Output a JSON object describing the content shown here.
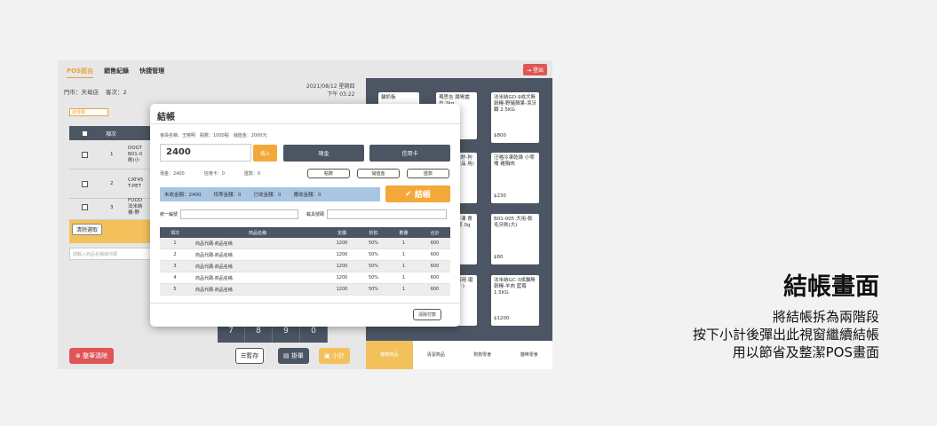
{
  "nav": {
    "tab_pos": "POS前台",
    "tab_sales": "銷售紀錄",
    "tab_shortcut": "快捷管理",
    "logout": "登出"
  },
  "store": {
    "store": "門市：天母店",
    "customers": "客次：2",
    "date": "2021/08/12 星期四",
    "time": "下午 03:22"
  },
  "filter_label": "搜尋類",
  "table": {
    "headers": [
      "項次"
    ],
    "rows": [
      {
        "num": "1",
        "code": "DOGT",
        "name": "B01-0",
        "extra": "刷(小"
      },
      {
        "num": "2",
        "code": "CAT45",
        "name": "T-PET",
        "extra": ""
      },
      {
        "num": "3",
        "code": "FOOD",
        "name": "法米納",
        "extra": "樣-野"
      }
    ]
  },
  "clear_selection": "清除選取",
  "search_placeholder": "請輸入商品名稱或代碼",
  "numkeys": [
    "7",
    "8",
    "9",
    "0"
  ],
  "buttons": {
    "clear_all": "整筆清除",
    "hold": "暫存",
    "list": "掛單",
    "subtotal": "小計"
  },
  "products": [
    {
      "name": "貓抓板",
      "price": ""
    },
    {
      "name": "瑪思吉 腸胃處方 2kg",
      "price": ""
    },
    {
      "name": "法米納GD-9成犬無穀糧-野豬蘋果-潔牙顆 2.5KG",
      "price": "$800"
    },
    {
      "name": "g 鹼舒-狗 附食品 用)",
      "price": ""
    },
    {
      "name": "汪喵冷凍乾燥 小零嘴 雞胸肉",
      "price": "$230"
    },
    {
      "name": "即冷凍 食餐 草 0g",
      "price": ""
    },
    {
      "name": "B01-005 犬用-軟毛牙刷(大)",
      "price": "$80"
    },
    {
      "name": "ky兩用 磨爪牙 )",
      "price": ""
    },
    {
      "name": "法米納GC-3成貓無穀糧-羊肉 藍莓1.5KG",
      "price": "$1200"
    }
  ],
  "categories": [
    "寵物商品",
    "清潔商品",
    "狗狗零食",
    "貓咪零食"
  ],
  "modal": {
    "title": "結帳",
    "member": "會員名稱：王曉明　點數：1000點　儲值金：2000元",
    "amount": "2400",
    "fill": "填入",
    "cash": "現金",
    "credit": "信用卡",
    "pay_cash": "現金：2400",
    "pay_credit": "信用卡：0",
    "pay_transfer": "匯款：0",
    "btn_points": "點數",
    "btn_stored": "儲值金",
    "btn_transfer": "匯款",
    "sum_unreceived": "未收金額：2400",
    "sum_change": "找零金額：0",
    "sum_received": "已收金額：0",
    "sum_due": "應收金額：0",
    "checkout": "結帳",
    "taxid_label": "統一編號",
    "carrier_label": "載具號碼",
    "headers": [
      "項次",
      "商品名稱",
      "定價",
      "折扣",
      "數量",
      "合計"
    ],
    "rows": [
      {
        "num": "1",
        "name": "商品代碼-商品名稱",
        "price": "1200",
        "discount": "50%",
        "qty": "1",
        "total": "600"
      },
      {
        "num": "2",
        "name": "商品代碼-商品名稱",
        "price": "1200",
        "discount": "50%",
        "qty": "1",
        "total": "600"
      },
      {
        "num": "3",
        "name": "商品代碼-商品名稱",
        "price": "1200",
        "discount": "50%",
        "qty": "1",
        "total": "600"
      },
      {
        "num": "4",
        "name": "商品代碼-商品名稱",
        "price": "1200",
        "discount": "50%",
        "qty": "1",
        "total": "600"
      },
      {
        "num": "5",
        "name": "商品代碼-商品名稱",
        "price": "1200",
        "discount": "50%",
        "qty": "1",
        "total": "600"
      }
    ],
    "clear_payment": "清除付款"
  },
  "caption": {
    "title": "結帳畫面",
    "line1": "將結帳拆為兩階段",
    "line2": "按下小計後彈出此視窗繼續結帳",
    "line3": "用以節省及整潔POS畫面"
  },
  "colors": {
    "accent": "#f3a83a",
    "dark": "#4b5563",
    "danger": "#e05555",
    "summary": "#a9c5e4"
  }
}
